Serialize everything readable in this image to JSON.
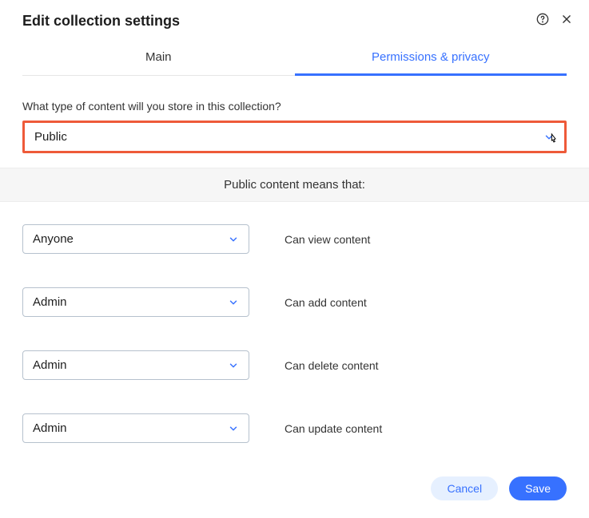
{
  "header": {
    "title": "Edit collection settings"
  },
  "tabs": {
    "main": "Main",
    "permissions": "Permissions & privacy"
  },
  "content_type": {
    "label": "What type of content will you store in this collection?",
    "value": "Public"
  },
  "banner": "Public content means that:",
  "permissions": [
    {
      "role": "Anyone",
      "desc": "Can view content"
    },
    {
      "role": "Admin",
      "desc": "Can add content"
    },
    {
      "role": "Admin",
      "desc": "Can delete content"
    },
    {
      "role": "Admin",
      "desc": "Can update content"
    }
  ],
  "footer": {
    "cancel": "Cancel",
    "save": "Save"
  }
}
